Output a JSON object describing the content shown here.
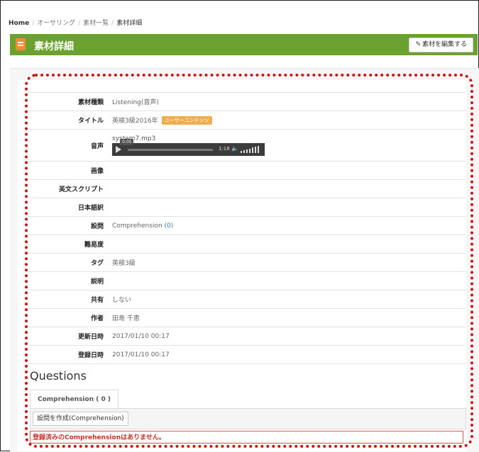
{
  "breadcrumb": {
    "home": "Home",
    "item1": "オーサリング",
    "item2": "素材一覧",
    "current": "素材詳細"
  },
  "header": {
    "title": "素材詳細",
    "edit_button": "素材を編集する",
    "bar_color": "#6aa12f"
  },
  "details": {
    "type": {
      "label": "素材種類",
      "value": "Listening(音声)"
    },
    "title": {
      "label": "タイトル",
      "value": "英検3級2016年",
      "badge": "ユーザーコンテンツ"
    },
    "audio": {
      "label": "音声",
      "file": "system7.mp3",
      "current_time": "0:00",
      "duration": "1:18"
    },
    "image": {
      "label": "画像",
      "value": ""
    },
    "script_en": {
      "label": "英文スクリプト",
      "value": ""
    },
    "translation_ja": {
      "label": "日本語訳",
      "value": ""
    },
    "questions": {
      "label": "設問",
      "value": "Comprehension",
      "count": "(0)"
    },
    "difficulty": {
      "label": "難易度",
      "value": ""
    },
    "tags": {
      "label": "タグ",
      "value": "英検3級"
    },
    "description": {
      "label": "説明",
      "value": ""
    },
    "share": {
      "label": "共有",
      "value": "しない"
    },
    "author": {
      "label": "作者",
      "value": "田島 千恵"
    },
    "updated": {
      "label": "更新日時",
      "value": "2017/01/10 00:17"
    },
    "registered": {
      "label": "登録日時",
      "value": "2017/01/10 00:17"
    }
  },
  "questions_section": {
    "heading": "Questions",
    "tab_label": "Comprehension ( 0 )",
    "create_button": "設問を作成(Comprehension)",
    "empty_message": "登録済みのComprehensionはありません。"
  },
  "colors": {
    "accent": "#6aa12f",
    "badge": "#f0ad4e",
    "alert": "#d9534f",
    "annotation": "#d01010"
  }
}
